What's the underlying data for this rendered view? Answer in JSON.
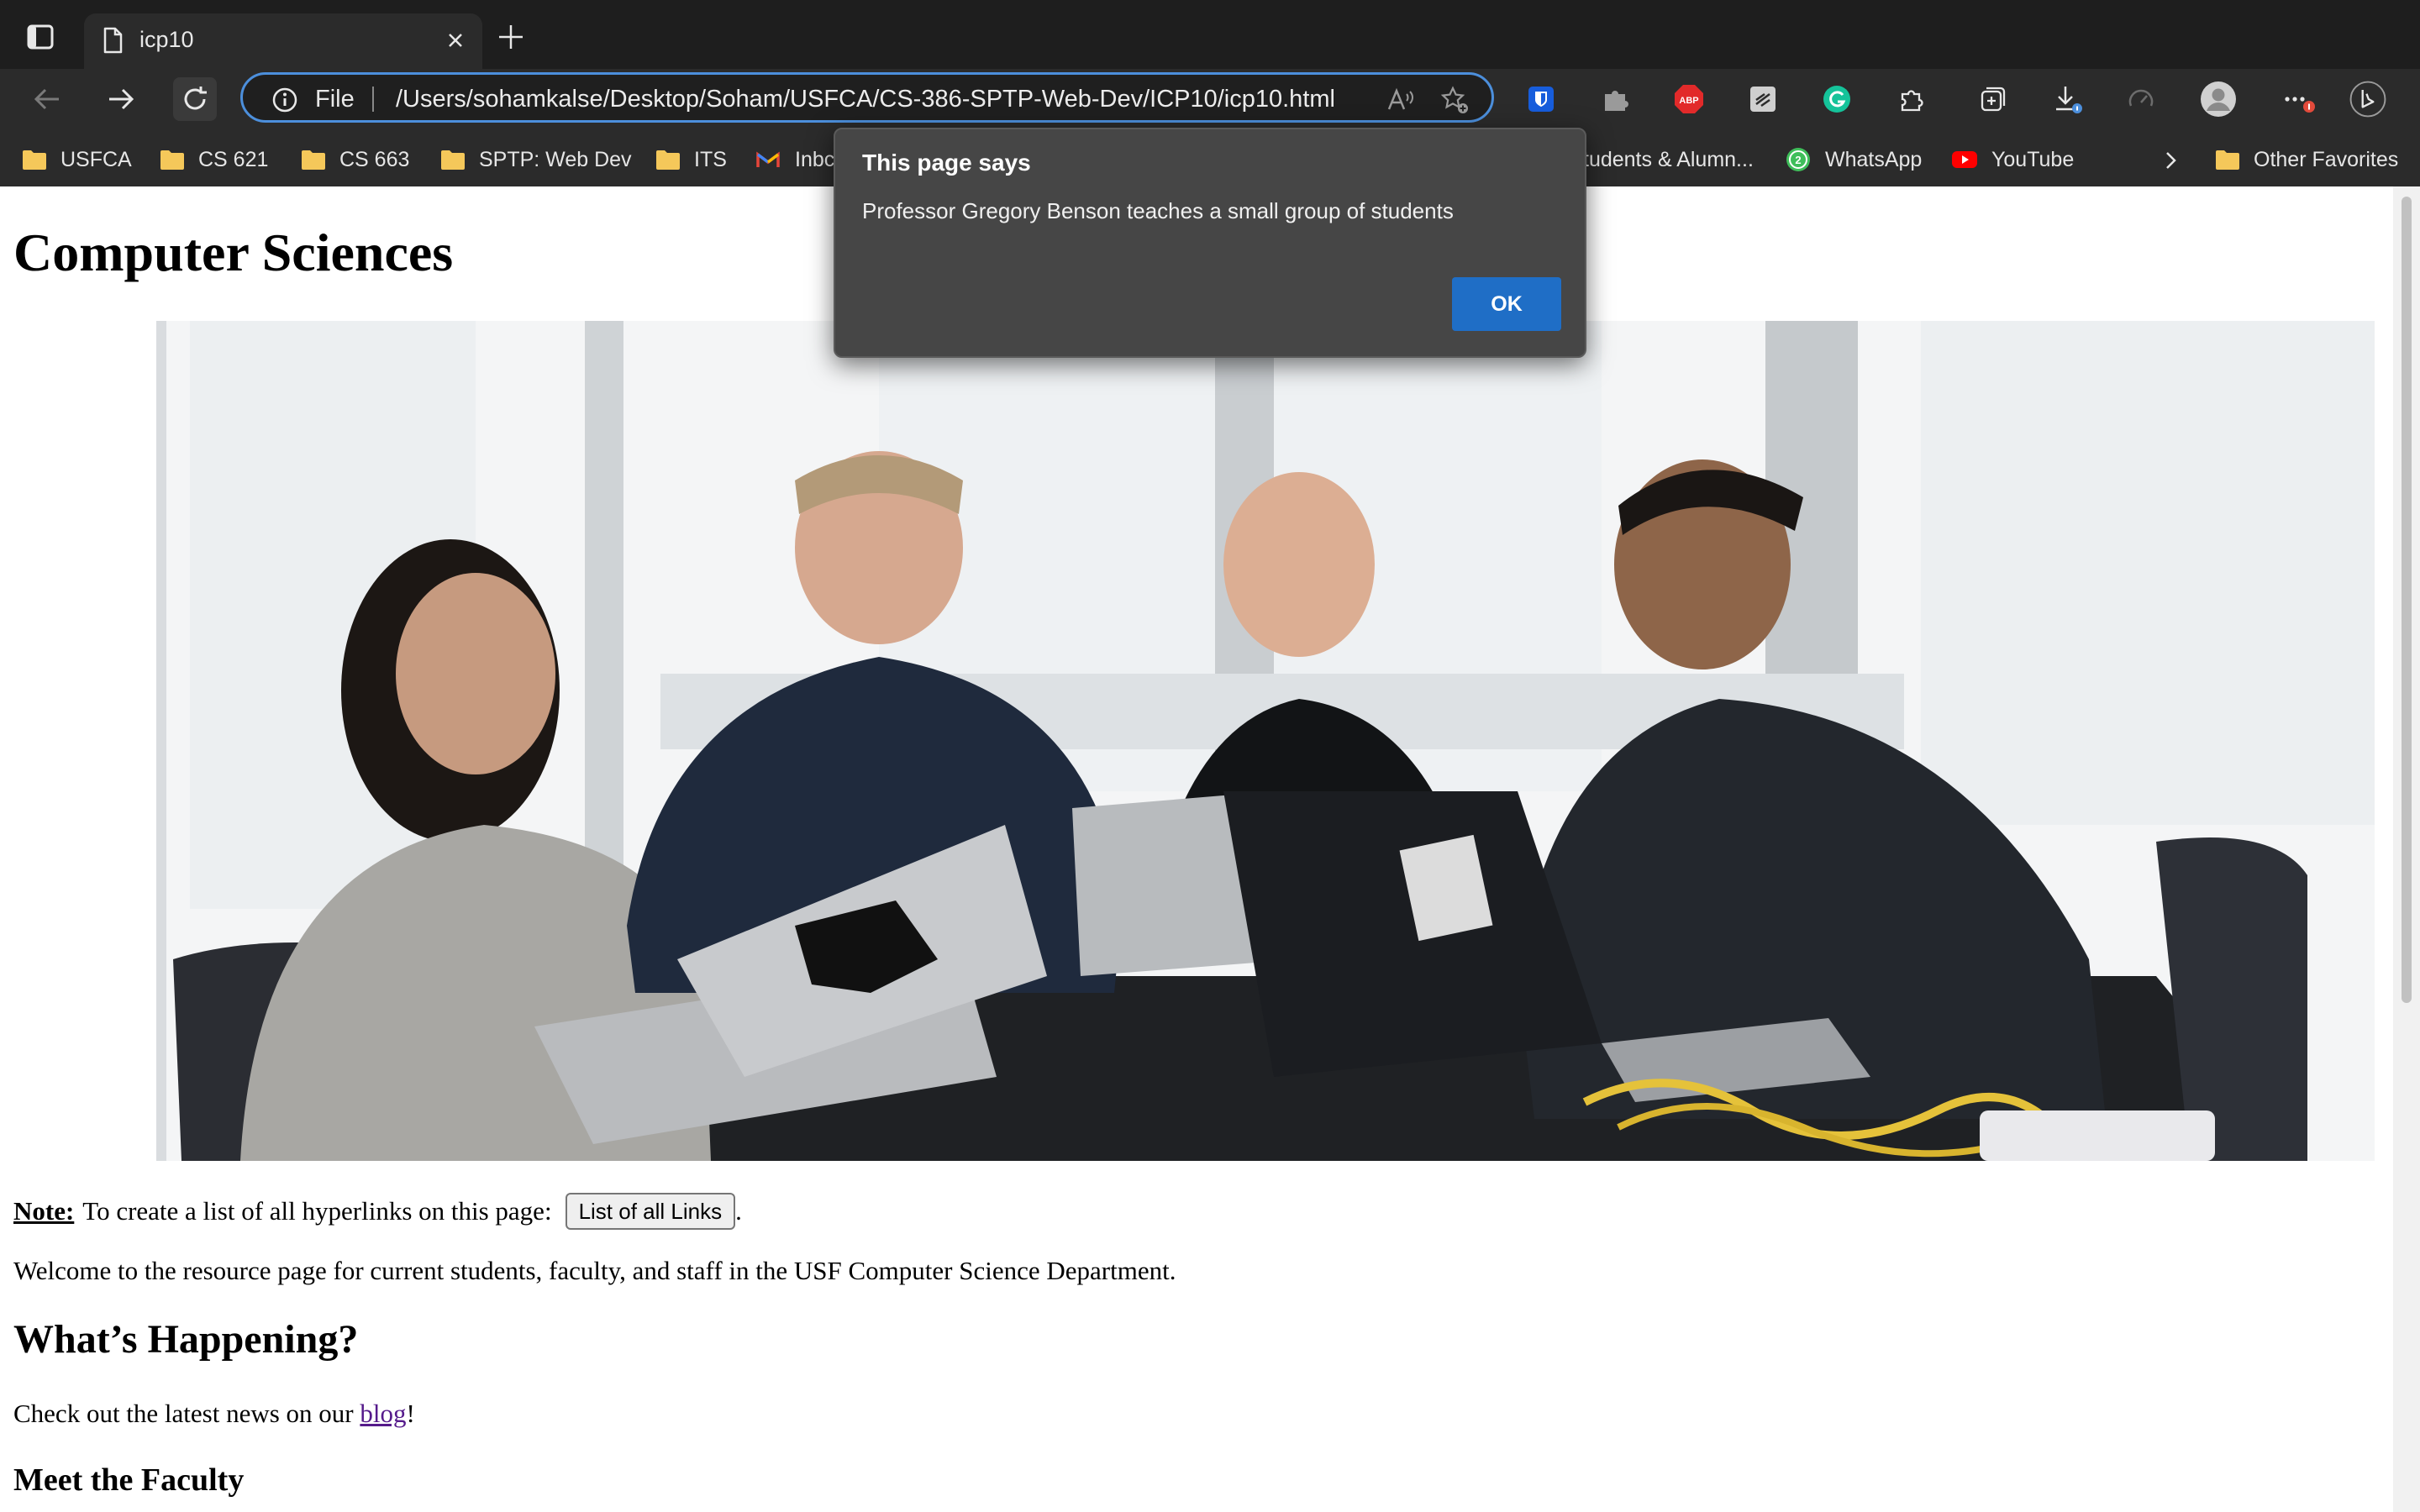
{
  "browser": {
    "tab_title": "icp10",
    "omnibox": {
      "scheme_label": "File",
      "url": "/Users/sohamkalse/Desktop/Soham/USFCA/CS-386-SPTP-Web-Dev/ICP10/icp10.html"
    },
    "extensions": {
      "abp_label": "ABP"
    },
    "bookmarks": [
      {
        "label": "USFCA",
        "icon": "folder-icon"
      },
      {
        "label": "CS 621",
        "icon": "folder-icon"
      },
      {
        "label": "CS 663",
        "icon": "folder-icon"
      },
      {
        "label": "SPTP: Web Dev",
        "icon": "folder-icon"
      },
      {
        "label": "ITS",
        "icon": "folder-icon"
      },
      {
        "label": "Inbc",
        "icon": "gmail-icon"
      },
      {
        "label": "tudents & Alumn...",
        "icon": "none"
      },
      {
        "label": "WhatsApp",
        "icon": "whatsapp-icon",
        "badge": "2"
      },
      {
        "label": "YouTube",
        "icon": "youtube-icon"
      }
    ],
    "other_favorites": "Other Favorites",
    "colors": {
      "accent": "#4c8fdc",
      "chrome_bg": "#2b2b2b",
      "tabstrip_bg": "#1e1e1e"
    }
  },
  "page": {
    "heading": "Computer Sciences",
    "note_label": "Note:",
    "note_text": "To create a list of all hyperlinks on this page:",
    "links_button": "List of all Links",
    "note_end": ".",
    "welcome": "Welcome to the resource page for current students, faculty, and staff in the USF Computer Science Department.",
    "happening_heading": "What’s Happening?",
    "news_text": "Check out the latest news on our",
    "news_link": "blog",
    "news_end": "!",
    "faculty_heading": "Meet the Faculty"
  },
  "dialog": {
    "title": "This page says",
    "message": "Professor Gregory Benson teaches a small group of students",
    "ok_label": "OK",
    "ok_color": "#1f6ec6"
  }
}
